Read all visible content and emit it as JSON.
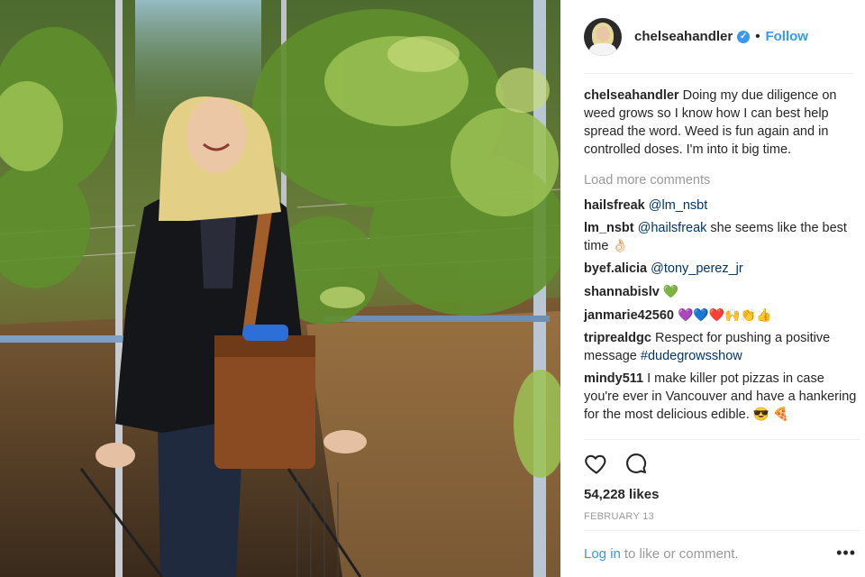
{
  "header": {
    "username": "chelseahandler",
    "separator": "•",
    "follow_label": "Follow"
  },
  "caption": {
    "user": "chelseahandler",
    "text": "Doing my due diligence on weed grows so I know how I can best help spread the word. Weed is fun again and in controlled doses. I'm into it big time."
  },
  "load_more_label": "Load more comments",
  "comments": [
    {
      "user": "hailsfreak",
      "mention": "@lm_nsbt",
      "text": ""
    },
    {
      "user": "lm_nsbt",
      "mention": "@hailsfreak",
      "text": " she seems like the best time 👌🏻"
    },
    {
      "user": "byef.alicia",
      "mention": "@tony_perez_jr",
      "text": ""
    },
    {
      "user": "shannabislv",
      "mention": "",
      "text": "💚"
    },
    {
      "user": "janmarie42560",
      "mention": "",
      "text": "💜💙❤️🙌👏👍"
    },
    {
      "user": "triprealdgc",
      "mention": "",
      "text": "Respect for pushing a positive message ",
      "tag": "#dudegrowsshow"
    },
    {
      "user": "mindy511",
      "mention": "",
      "text": "I make killer pot pizzas in case you're ever in Vancouver and have a hankering for the most delicious edible. 😎 🍕"
    }
  ],
  "likes": "54,228 likes",
  "date": "FEBRUARY 13",
  "footer": {
    "login_label": "Log in",
    "rest": "to like or comment.",
    "more": "•••"
  },
  "icons": {
    "like": "heart-icon",
    "comment": "comment-bubble-icon",
    "verified": "verified-badge-icon",
    "more": "more-options-icon"
  },
  "colors": {
    "accent": "#3897f0",
    "mention": "#003569",
    "muted": "#999999",
    "text": "#262626"
  }
}
